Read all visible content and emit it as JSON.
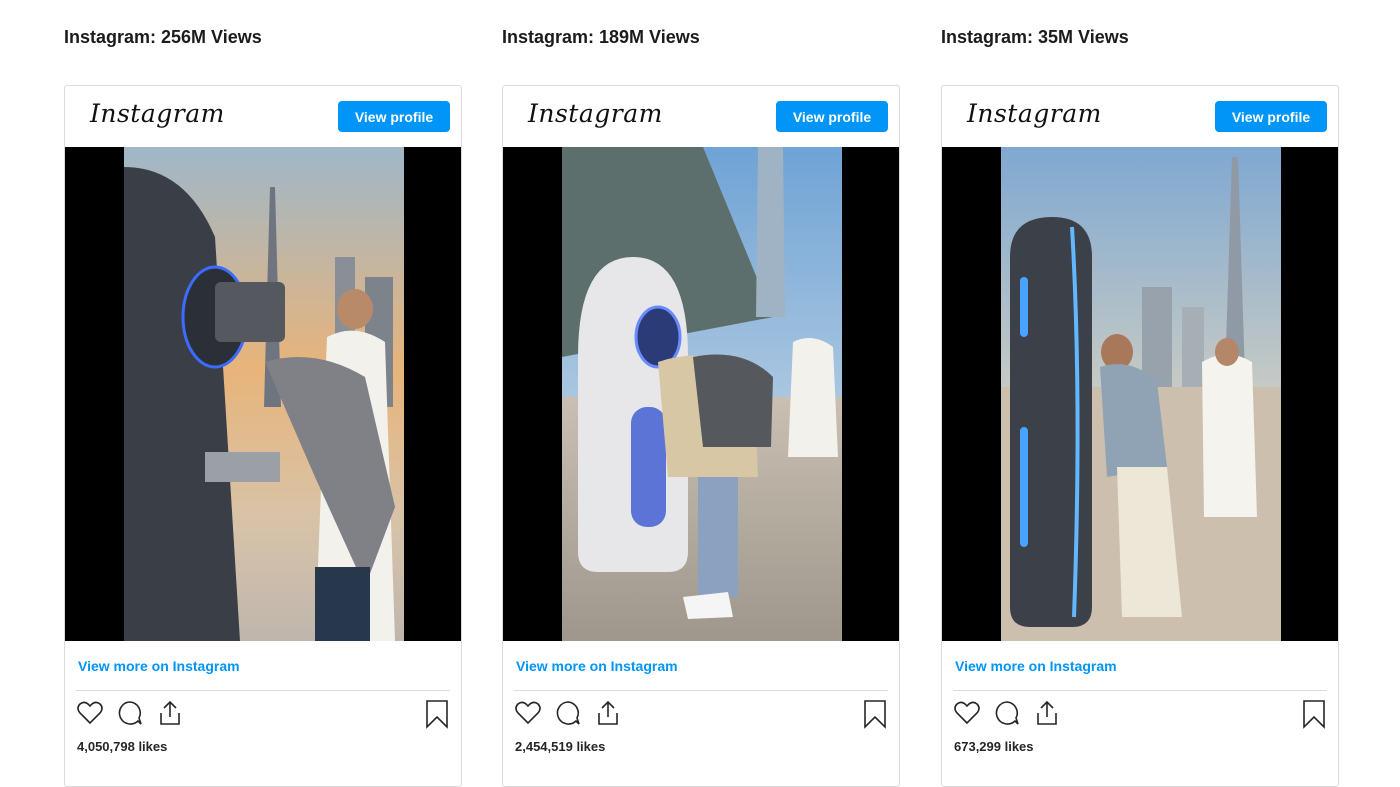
{
  "cards": [
    {
      "title": "Instagram: 256M Views",
      "logo_text": "Instagram",
      "view_profile": "View profile",
      "view_more": "View more on Instagram",
      "likes": "4,050,798 likes"
    },
    {
      "title": "Instagram: 189M Views",
      "logo_text": "Instagram",
      "view_profile": "View profile",
      "view_more": "View more on Instagram",
      "likes": "2,454,519 likes"
    },
    {
      "title": "Instagram: 35M Views",
      "logo_text": "Instagram",
      "view_profile": "View profile",
      "view_more": "View more on Instagram",
      "likes": "673,299 likes"
    }
  ],
  "icons": [
    "heart-icon",
    "comment-icon",
    "share-icon",
    "bookmark-icon"
  ],
  "colors": {
    "accent": "#0095f6",
    "border": "#dbdbdb",
    "text": "#262626"
  }
}
